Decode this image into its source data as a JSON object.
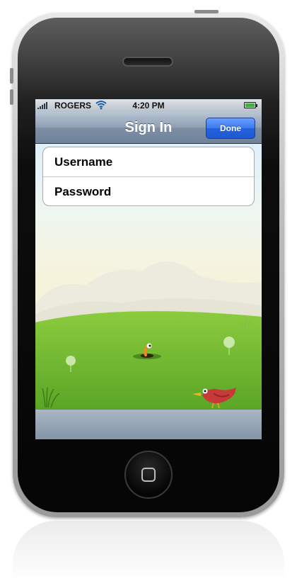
{
  "statusbar": {
    "carrier": "ROGERS",
    "time": "4:20 PM",
    "signal_bars": 5,
    "icons": [
      "signal-bars-icon",
      "wifi-icon",
      "battery-icon"
    ]
  },
  "navbar": {
    "title": "Sign In",
    "done_label": "Done"
  },
  "form": {
    "username_label": "Username",
    "password_label": "Password"
  },
  "colors": {
    "nav_bar": "#8e9fb3",
    "done_button": "#2462df",
    "grass": "#6cb52e",
    "sky": "#e8f4fb",
    "blue_bird": "#2e7fd6",
    "red_bird": "#c83a3a"
  },
  "scene": {
    "icons": [
      "blue-bird-icon",
      "red-bird-icon",
      "worm-icon",
      "dandelion-icon",
      "grass-tuft-icon",
      "hills-icon"
    ]
  }
}
